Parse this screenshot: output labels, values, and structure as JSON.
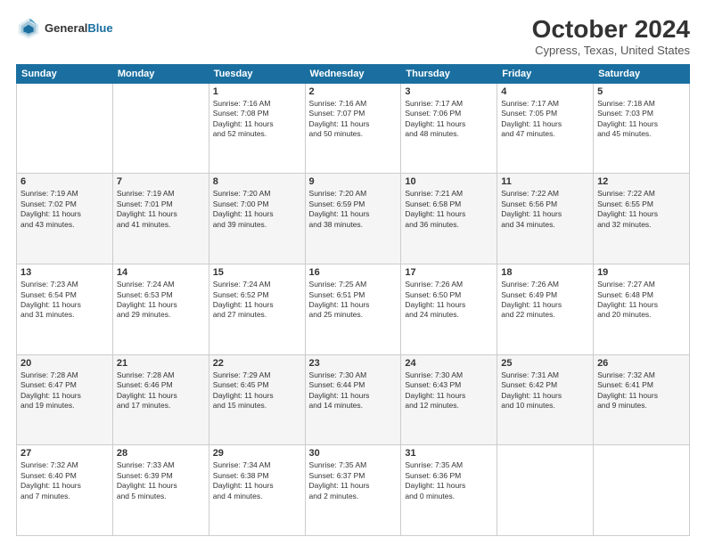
{
  "header": {
    "logo_line1": "General",
    "logo_line2": "Blue",
    "month": "October 2024",
    "location": "Cypress, Texas, United States"
  },
  "weekdays": [
    "Sunday",
    "Monday",
    "Tuesday",
    "Wednesday",
    "Thursday",
    "Friday",
    "Saturday"
  ],
  "weeks": [
    [
      {
        "day": "",
        "info": ""
      },
      {
        "day": "",
        "info": ""
      },
      {
        "day": "1",
        "info": "Sunrise: 7:16 AM\nSunset: 7:08 PM\nDaylight: 11 hours\nand 52 minutes."
      },
      {
        "day": "2",
        "info": "Sunrise: 7:16 AM\nSunset: 7:07 PM\nDaylight: 11 hours\nand 50 minutes."
      },
      {
        "day": "3",
        "info": "Sunrise: 7:17 AM\nSunset: 7:06 PM\nDaylight: 11 hours\nand 48 minutes."
      },
      {
        "day": "4",
        "info": "Sunrise: 7:17 AM\nSunset: 7:05 PM\nDaylight: 11 hours\nand 47 minutes."
      },
      {
        "day": "5",
        "info": "Sunrise: 7:18 AM\nSunset: 7:03 PM\nDaylight: 11 hours\nand 45 minutes."
      }
    ],
    [
      {
        "day": "6",
        "info": "Sunrise: 7:19 AM\nSunset: 7:02 PM\nDaylight: 11 hours\nand 43 minutes."
      },
      {
        "day": "7",
        "info": "Sunrise: 7:19 AM\nSunset: 7:01 PM\nDaylight: 11 hours\nand 41 minutes."
      },
      {
        "day": "8",
        "info": "Sunrise: 7:20 AM\nSunset: 7:00 PM\nDaylight: 11 hours\nand 39 minutes."
      },
      {
        "day": "9",
        "info": "Sunrise: 7:20 AM\nSunset: 6:59 PM\nDaylight: 11 hours\nand 38 minutes."
      },
      {
        "day": "10",
        "info": "Sunrise: 7:21 AM\nSunset: 6:58 PM\nDaylight: 11 hours\nand 36 minutes."
      },
      {
        "day": "11",
        "info": "Sunrise: 7:22 AM\nSunset: 6:56 PM\nDaylight: 11 hours\nand 34 minutes."
      },
      {
        "day": "12",
        "info": "Sunrise: 7:22 AM\nSunset: 6:55 PM\nDaylight: 11 hours\nand 32 minutes."
      }
    ],
    [
      {
        "day": "13",
        "info": "Sunrise: 7:23 AM\nSunset: 6:54 PM\nDaylight: 11 hours\nand 31 minutes."
      },
      {
        "day": "14",
        "info": "Sunrise: 7:24 AM\nSunset: 6:53 PM\nDaylight: 11 hours\nand 29 minutes."
      },
      {
        "day": "15",
        "info": "Sunrise: 7:24 AM\nSunset: 6:52 PM\nDaylight: 11 hours\nand 27 minutes."
      },
      {
        "day": "16",
        "info": "Sunrise: 7:25 AM\nSunset: 6:51 PM\nDaylight: 11 hours\nand 25 minutes."
      },
      {
        "day": "17",
        "info": "Sunrise: 7:26 AM\nSunset: 6:50 PM\nDaylight: 11 hours\nand 24 minutes."
      },
      {
        "day": "18",
        "info": "Sunrise: 7:26 AM\nSunset: 6:49 PM\nDaylight: 11 hours\nand 22 minutes."
      },
      {
        "day": "19",
        "info": "Sunrise: 7:27 AM\nSunset: 6:48 PM\nDaylight: 11 hours\nand 20 minutes."
      }
    ],
    [
      {
        "day": "20",
        "info": "Sunrise: 7:28 AM\nSunset: 6:47 PM\nDaylight: 11 hours\nand 19 minutes."
      },
      {
        "day": "21",
        "info": "Sunrise: 7:28 AM\nSunset: 6:46 PM\nDaylight: 11 hours\nand 17 minutes."
      },
      {
        "day": "22",
        "info": "Sunrise: 7:29 AM\nSunset: 6:45 PM\nDaylight: 11 hours\nand 15 minutes."
      },
      {
        "day": "23",
        "info": "Sunrise: 7:30 AM\nSunset: 6:44 PM\nDaylight: 11 hours\nand 14 minutes."
      },
      {
        "day": "24",
        "info": "Sunrise: 7:30 AM\nSunset: 6:43 PM\nDaylight: 11 hours\nand 12 minutes."
      },
      {
        "day": "25",
        "info": "Sunrise: 7:31 AM\nSunset: 6:42 PM\nDaylight: 11 hours\nand 10 minutes."
      },
      {
        "day": "26",
        "info": "Sunrise: 7:32 AM\nSunset: 6:41 PM\nDaylight: 11 hours\nand 9 minutes."
      }
    ],
    [
      {
        "day": "27",
        "info": "Sunrise: 7:32 AM\nSunset: 6:40 PM\nDaylight: 11 hours\nand 7 minutes."
      },
      {
        "day": "28",
        "info": "Sunrise: 7:33 AM\nSunset: 6:39 PM\nDaylight: 11 hours\nand 5 minutes."
      },
      {
        "day": "29",
        "info": "Sunrise: 7:34 AM\nSunset: 6:38 PM\nDaylight: 11 hours\nand 4 minutes."
      },
      {
        "day": "30",
        "info": "Sunrise: 7:35 AM\nSunset: 6:37 PM\nDaylight: 11 hours\nand 2 minutes."
      },
      {
        "day": "31",
        "info": "Sunrise: 7:35 AM\nSunset: 6:36 PM\nDaylight: 11 hours\nand 0 minutes."
      },
      {
        "day": "",
        "info": ""
      },
      {
        "day": "",
        "info": ""
      }
    ]
  ]
}
